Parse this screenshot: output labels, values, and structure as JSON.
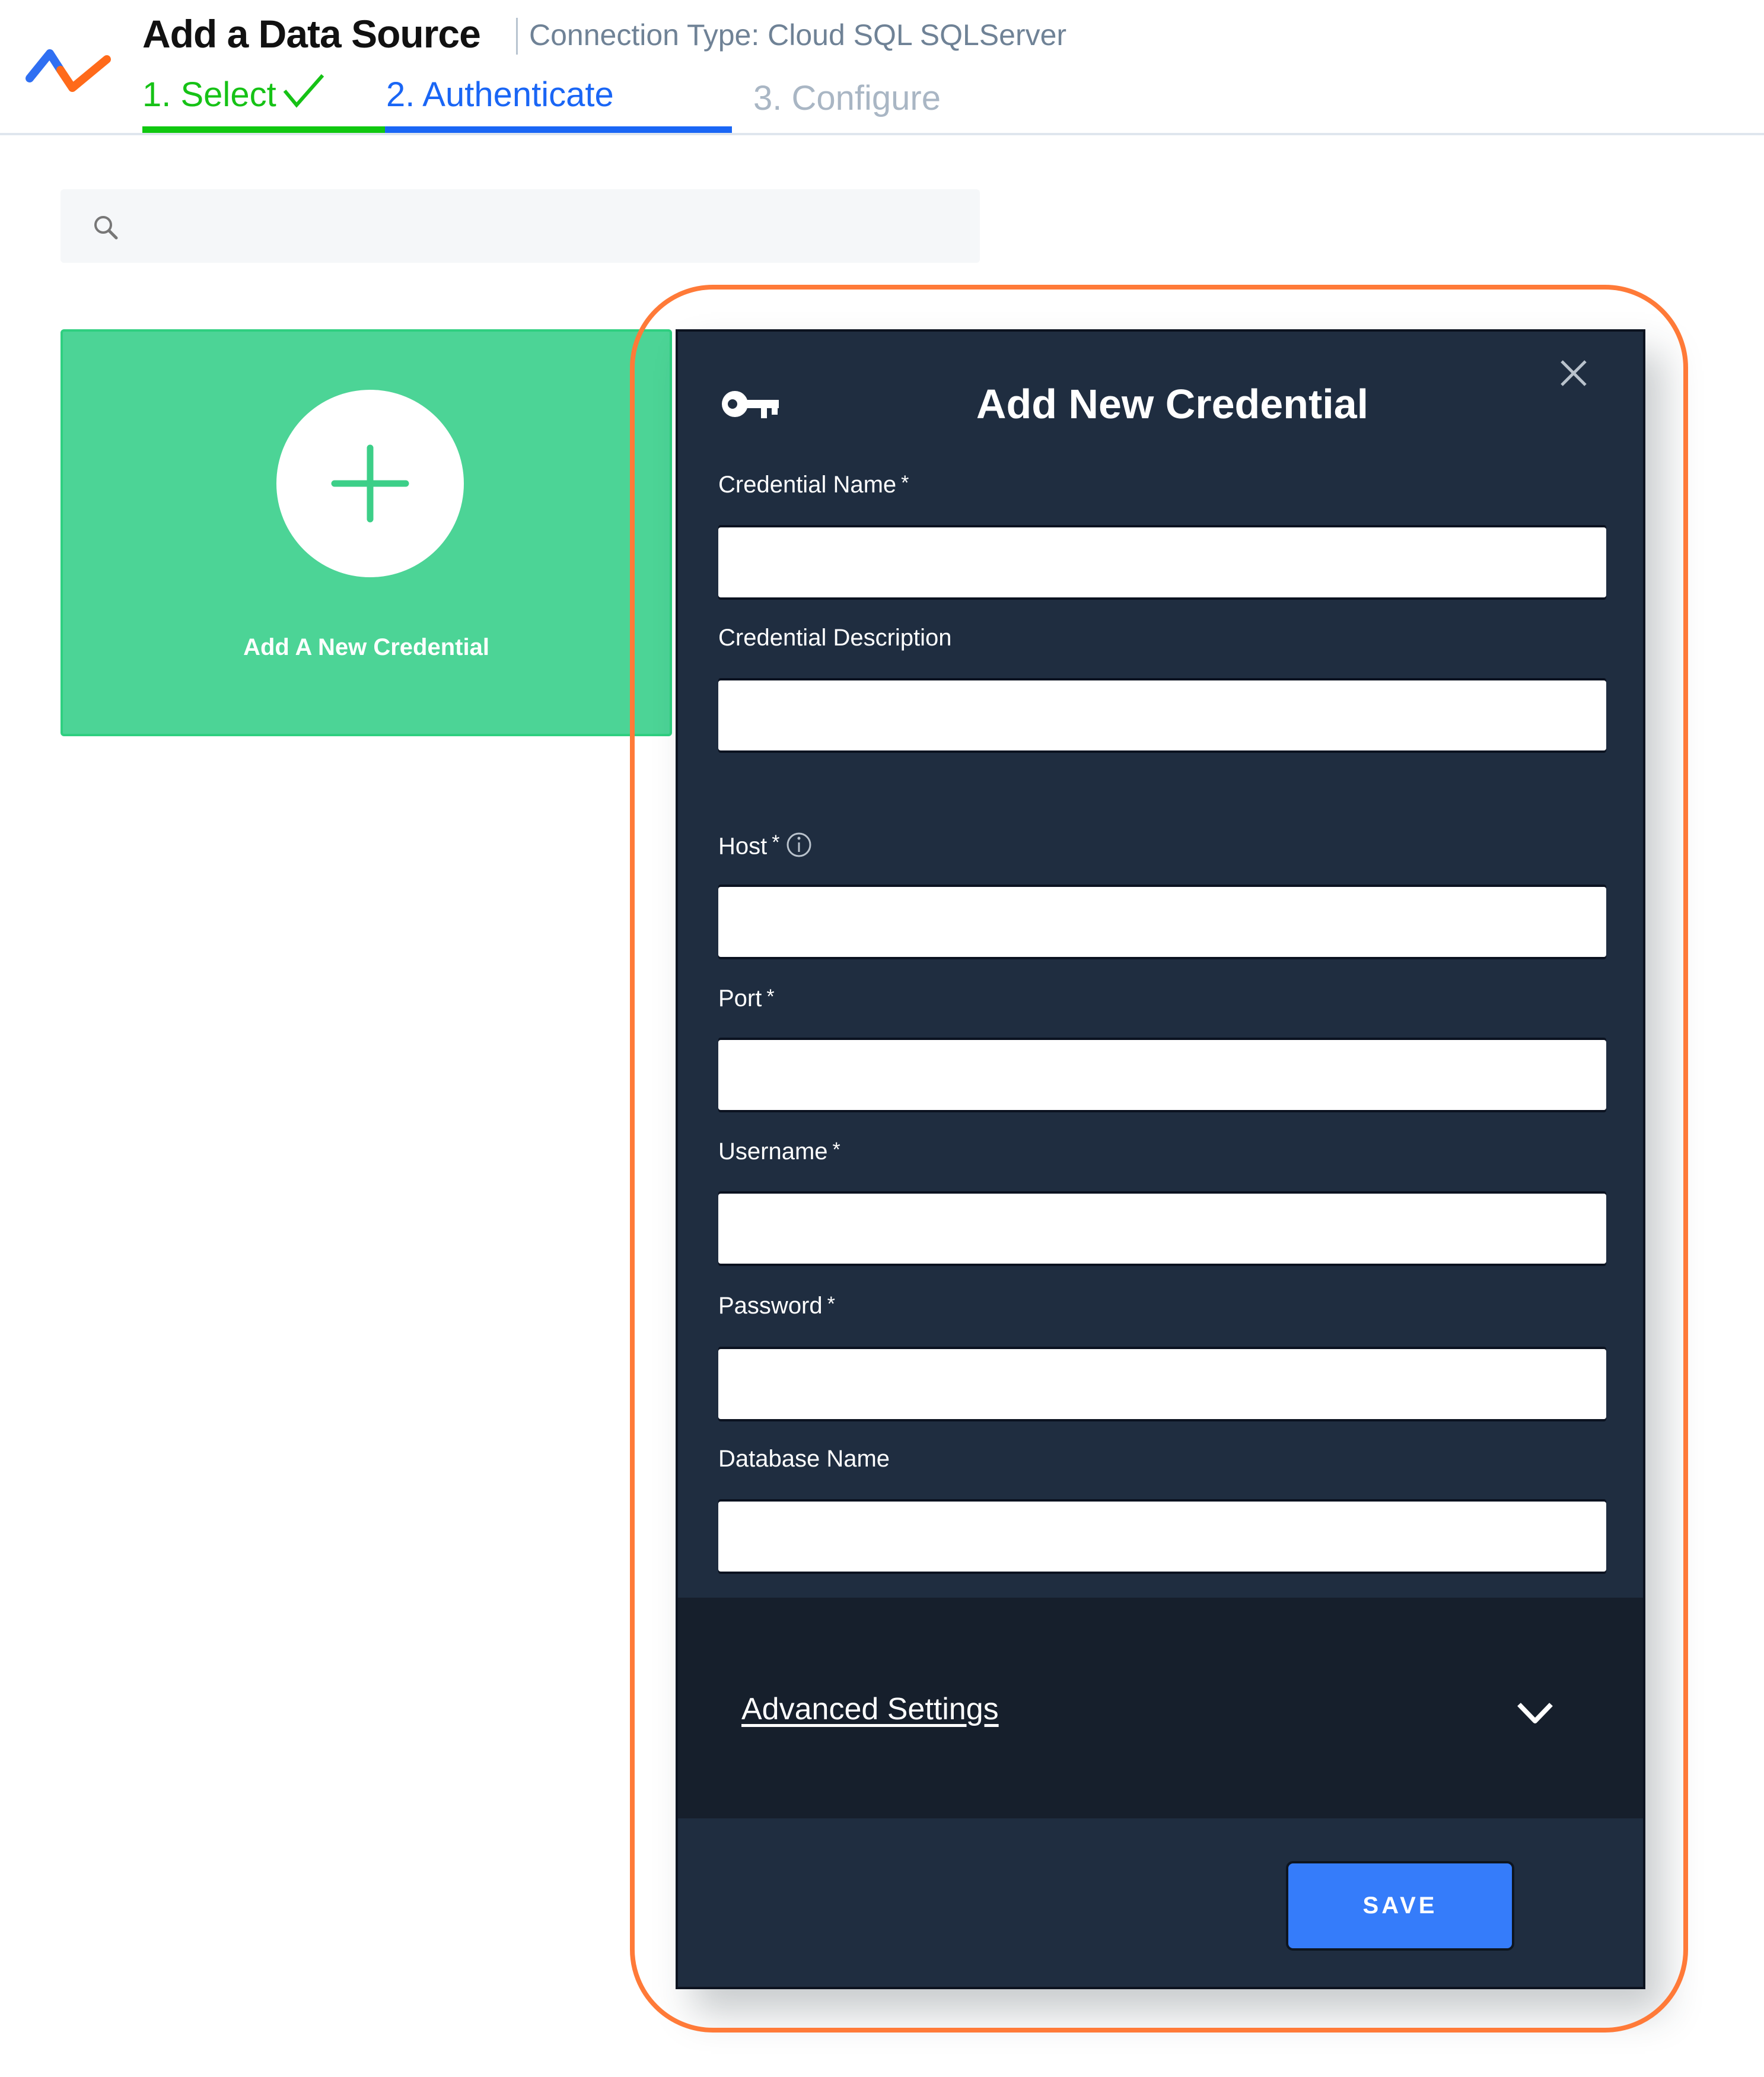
{
  "header": {
    "title": "Add a Data Source",
    "connection_type": "Connection Type: Cloud SQL SQLServer",
    "steps": [
      {
        "label": "1. Select",
        "state": "complete"
      },
      {
        "label": "2. Authenticate",
        "state": "active"
      },
      {
        "label": "3. Configure",
        "state": "upcoming"
      }
    ]
  },
  "search": {
    "value": "",
    "placeholder": ""
  },
  "add_card": {
    "label": "Add A New Credential"
  },
  "modal": {
    "title": "Add New Credential",
    "fields": [
      {
        "label": "Credential Name",
        "required": "*",
        "value": ""
      },
      {
        "label": "Credential Description",
        "required": "",
        "value": ""
      },
      {
        "label": "Host",
        "required": "*",
        "value": ""
      },
      {
        "label": "Port",
        "required": "*",
        "value": ""
      },
      {
        "label": "Username",
        "required": "*",
        "value": ""
      },
      {
        "label": "Password",
        "required": "*",
        "value": ""
      },
      {
        "label": "Database Name",
        "required": "",
        "value": ""
      }
    ],
    "advanced_settings_label": "Advanced Settings",
    "save_label": "SAVE"
  },
  "colors": {
    "step_complete": "#16c216",
    "step_active": "#1a66f5",
    "step_upcoming": "#a9b6c4",
    "card_green": "#4cd496",
    "modal_bg": "#1f2d40",
    "advanced_bg": "#161f2c",
    "save_button": "#357cfa",
    "highlight": "#ff7a38"
  }
}
